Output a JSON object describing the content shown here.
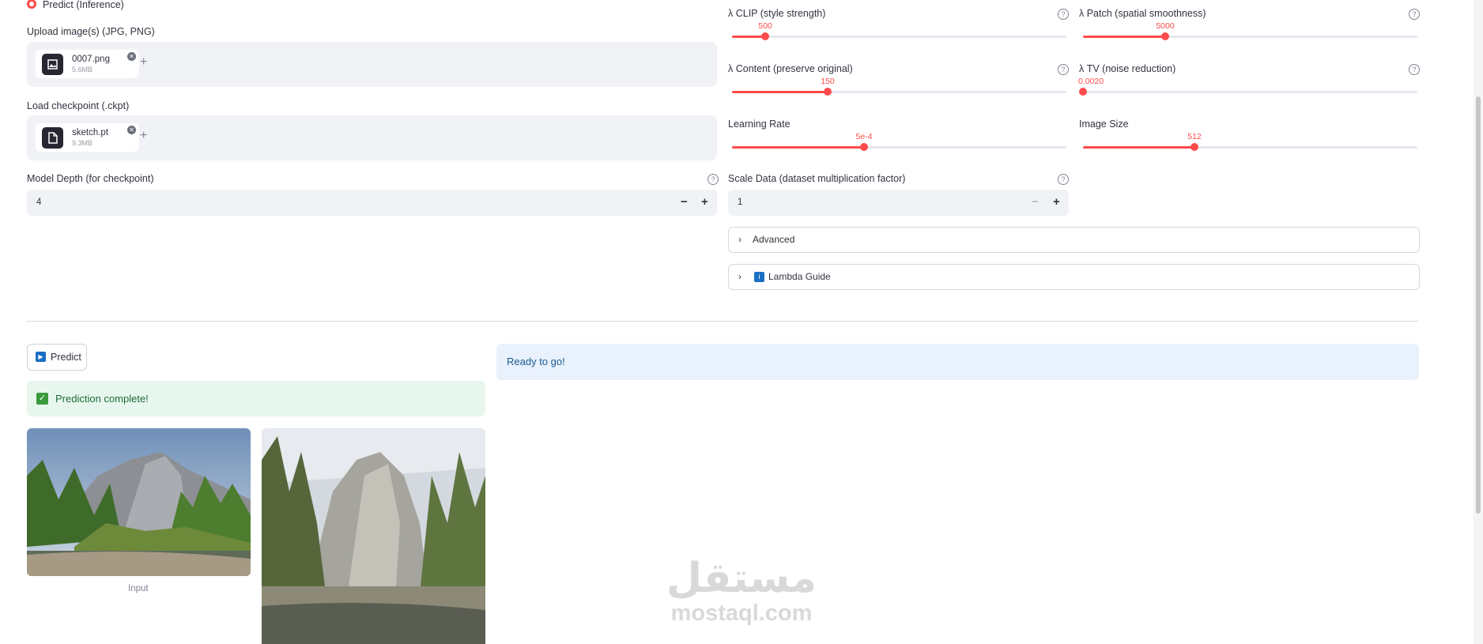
{
  "mode": {
    "label": "Predict (Inference)"
  },
  "upload_images": {
    "label": "Upload image(s) (JPG, PNG)",
    "file_name": "0007.png",
    "file_size": "5.6MB"
  },
  "checkpoint": {
    "label": "Load checkpoint (.ckpt)",
    "file_name": "sketch.pt",
    "file_size": "9.3MB"
  },
  "model_depth": {
    "label": "Model Depth (for checkpoint)",
    "value": "4"
  },
  "sliders": [
    {
      "label": "λ CLIP (style strength)",
      "value_text": "500",
      "fraction": 0.1
    },
    {
      "label": "λ Patch (spatial smoothness)",
      "value_text": "5000",
      "fraction": 0.245
    },
    {
      "label": "λ Content (preserve original)",
      "value_text": "150",
      "fraction": 0.285
    },
    {
      "label": "λ TV (noise reduction)",
      "value_text": "0.0020",
      "fraction": 0.0
    },
    {
      "label": "Learning Rate",
      "value_text": "5e-4",
      "fraction": 0.395
    },
    {
      "label": "Image Size",
      "value_text": "512",
      "fraction": 0.333
    }
  ],
  "scale_data": {
    "label": "Scale Data (dataset multiplication factor)",
    "value": "1"
  },
  "expanders": {
    "advanced": "Advanced",
    "lambda_guide": "Lambda Guide"
  },
  "predict_button": {
    "label": "Predict"
  },
  "status": {
    "success": "Prediction complete!",
    "info": "Ready to go!"
  },
  "images": {
    "input_caption": "Input"
  },
  "watermark": {
    "arabic": "مستقل",
    "latin": "mostaql.com"
  },
  "colors": {
    "accent": "#ff4b4b",
    "success_bg": "#e8f7ee",
    "info_bg": "#e8f1fc",
    "info_text": "#1c5a8f"
  }
}
